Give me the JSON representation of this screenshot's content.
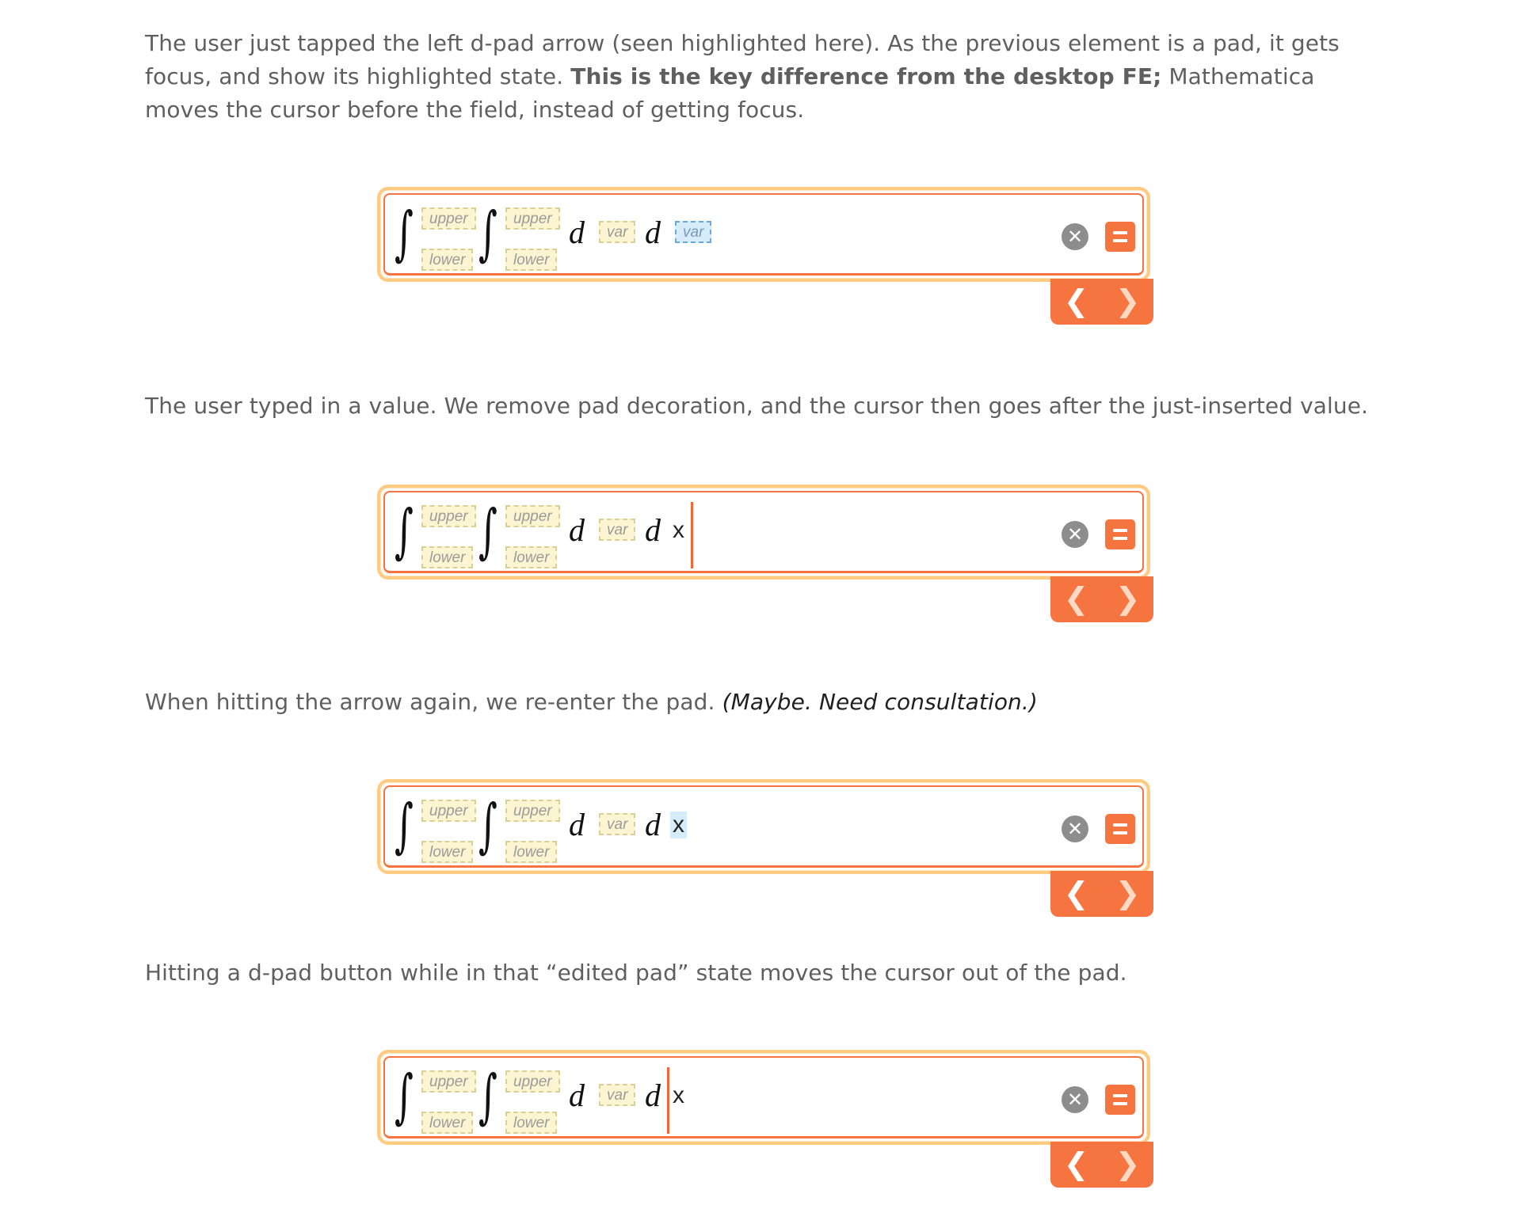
{
  "paragraphs": [
    {
      "pre": "The user just tapped the left d-pad arrow (seen highlighted here). As the previous element is a pad, it gets focus, and show its highlighted state. ",
      "bold": "This is the key difference from the desktop FE;",
      "post": " Mathematica moves the cursor before the field, instead of getting focus."
    },
    {
      "text": "The user typed in a value. We remove pad decoration, and the cursor then goes after the just-inserted value."
    },
    {
      "text": "When hitting the arrow again, we re-enter the pad. ",
      "italic": "(Maybe. Need consultation.)"
    },
    {
      "text": "Hitting a d-pad button while in that “edited pad” state moves the cursor out of the pad."
    }
  ],
  "pads": {
    "upper": "upper",
    "lower": "lower",
    "var": "var"
  },
  "symbols": {
    "integral": "∫",
    "d": "d",
    "x": "x",
    "clear": "✕",
    "left_arrow": "❮",
    "right_arrow": "❯"
  },
  "widgets": [
    {
      "state": "second var pad focused (highlighted)",
      "second_var_content": "var",
      "left_arrow_highlighted": true
    },
    {
      "state": "value x typed, cursor after value",
      "second_var_content": "x",
      "left_arrow_highlighted": false
    },
    {
      "state": "pad re-entered, x selected",
      "second_var_content": "x",
      "left_arrow_highlighted": true
    },
    {
      "state": "cursor moved out of pad, before x",
      "second_var_content": "x",
      "left_arrow_highlighted": true
    }
  ],
  "colors": {
    "accent": "#f6743f",
    "field_outline": "#ffcb80",
    "pad_fill": "#fdf5d2",
    "pad_active": "#d6ecfb"
  }
}
